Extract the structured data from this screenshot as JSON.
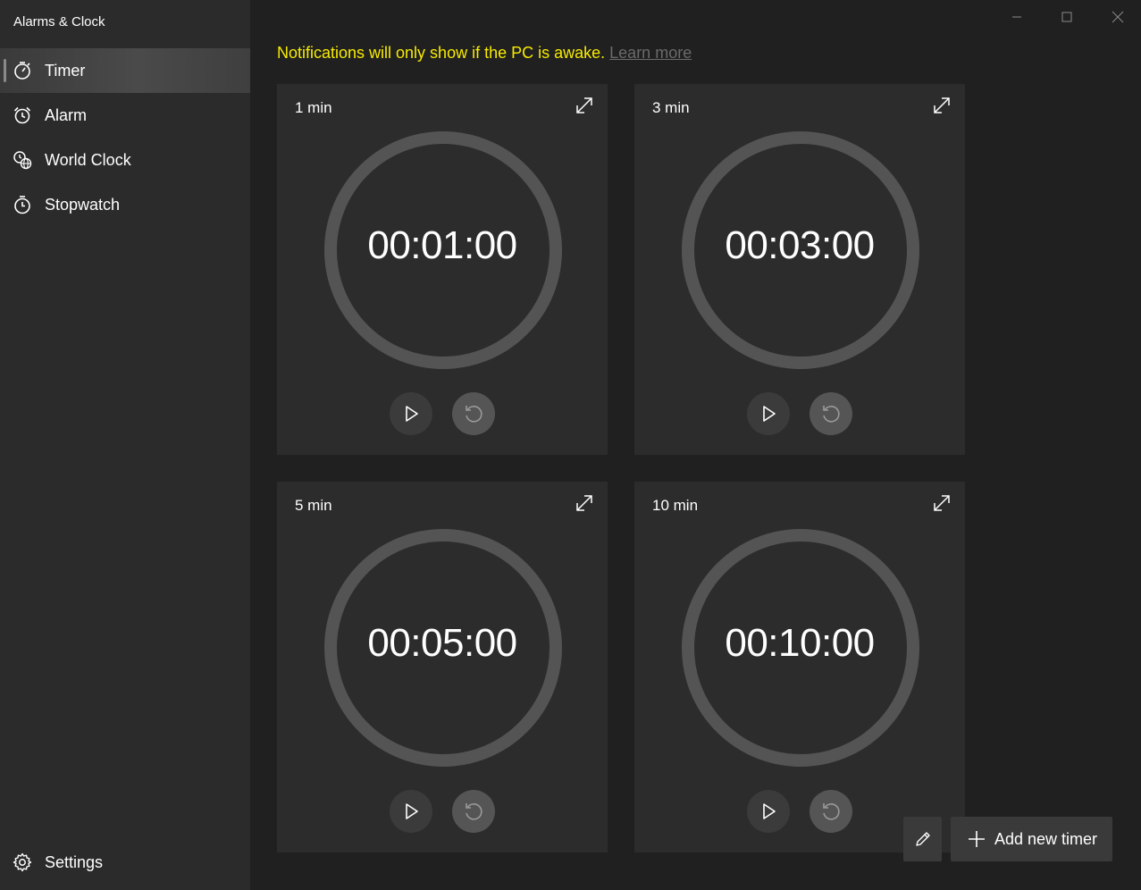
{
  "app": {
    "title": "Alarms & Clock"
  },
  "nav": {
    "items": [
      {
        "label": "Timer",
        "icon": "timer-icon",
        "selected": true
      },
      {
        "label": "Alarm",
        "icon": "alarm-icon",
        "selected": false
      },
      {
        "label": "World Clock",
        "icon": "world-clock-icon",
        "selected": false
      },
      {
        "label": "Stopwatch",
        "icon": "stopwatch-icon",
        "selected": false
      }
    ],
    "settings": {
      "label": "Settings",
      "icon": "gear-icon"
    }
  },
  "window_controls": [
    "minimize-icon",
    "maximize-icon",
    "close-icon"
  ],
  "notice": {
    "text": "Notifications will only show if the PC is awake.",
    "link": "Learn more",
    "color": "#f7eb00"
  },
  "timers": [
    {
      "name": "1 min",
      "time": "00:01:00"
    },
    {
      "name": "3 min",
      "time": "00:03:00"
    },
    {
      "name": "5 min",
      "time": "00:05:00"
    },
    {
      "name": "10 min",
      "time": "00:10:00"
    }
  ],
  "actions": {
    "edit_icon": "pencil-icon",
    "add_label": "Add new timer"
  }
}
